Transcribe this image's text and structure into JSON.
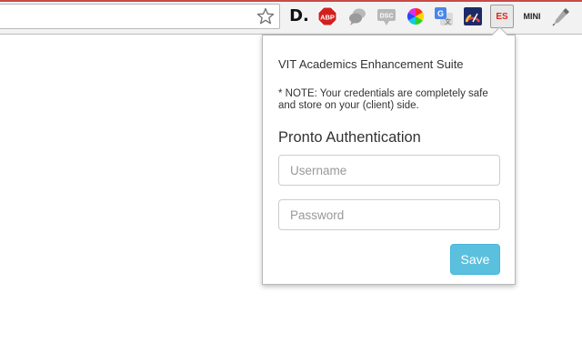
{
  "toolbar": {
    "extensions": [
      {
        "name": "d-icon",
        "label": "D."
      },
      {
        "name": "abp-icon",
        "label": "ABP"
      },
      {
        "name": "chat-bubble-icon",
        "label": ""
      },
      {
        "name": "dsc-icon",
        "label": "DSC"
      },
      {
        "name": "color-wheel-icon",
        "label": ""
      },
      {
        "name": "google-translate-icon",
        "label": ""
      },
      {
        "name": "speedometer-icon",
        "label": ""
      },
      {
        "name": "es-icon",
        "label": "ES"
      },
      {
        "name": "mini-icon",
        "label": "MINI"
      },
      {
        "name": "dropper-icon",
        "label": ""
      }
    ],
    "accent_color": "#d8281f"
  },
  "popup": {
    "title": "VIT Academics Enhancement Suite",
    "note": "* NOTE: Your credentials are completely safe and store on your (client) side.",
    "heading": "Pronto Authentication",
    "username": {
      "placeholder": "Username",
      "value": ""
    },
    "password": {
      "placeholder": "Password",
      "value": ""
    },
    "save_label": "Save",
    "save_color": "#5bc0de"
  }
}
